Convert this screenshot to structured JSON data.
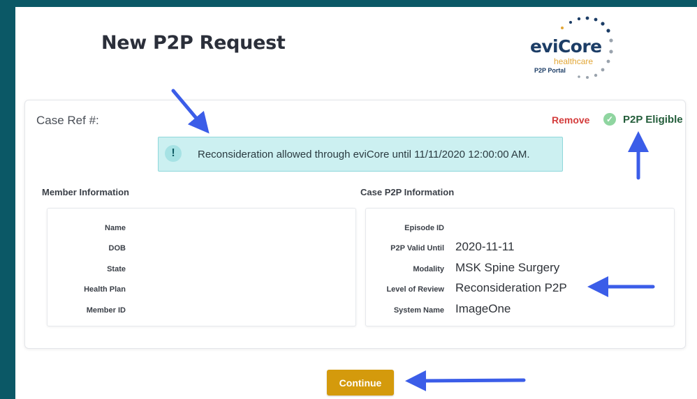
{
  "page": {
    "title": "New P2P Request"
  },
  "logo": {
    "brand": "eviCore",
    "sub": "healthcare",
    "portal": "P2P Portal"
  },
  "case": {
    "ref_label": "Case Ref #:",
    "remove_label": "Remove",
    "eligibility": "P2P Eligible",
    "eligibility_icon": "check-circle-icon"
  },
  "alert": {
    "icon": "exclamation-icon",
    "message": "Reconsideration allowed through eviCore until 11/11/2020 12:00:00 AM."
  },
  "member": {
    "heading": "Member Information",
    "fields": [
      {
        "label": "Name",
        "value": ""
      },
      {
        "label": "DOB",
        "value": ""
      },
      {
        "label": "State",
        "value": ""
      },
      {
        "label": "Health Plan",
        "value": ""
      },
      {
        "label": "Member ID",
        "value": ""
      }
    ]
  },
  "p2p": {
    "heading": "Case P2P Information",
    "fields": [
      {
        "label": "Episode ID",
        "value": ""
      },
      {
        "label": "P2P Valid Until",
        "value": "2020-11-11"
      },
      {
        "label": "Modality",
        "value": "MSK Spine Surgery"
      },
      {
        "label": "Level of Review",
        "value": "Reconsideration P2P"
      },
      {
        "label": "System Name",
        "value": "ImageOne"
      }
    ]
  },
  "actions": {
    "continue_label": "Continue"
  },
  "colors": {
    "accent": "#d49a0c",
    "teal": "#0b5866",
    "annotation_arrow": "#3b5de8"
  }
}
